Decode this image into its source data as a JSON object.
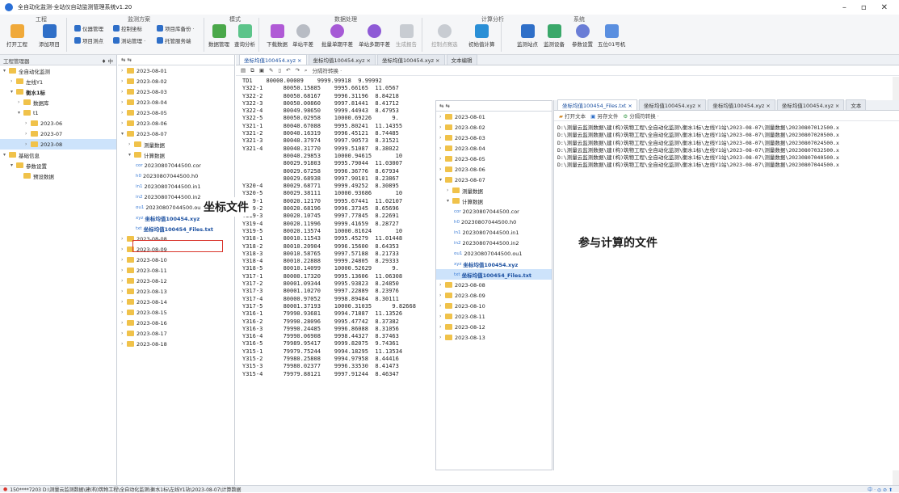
{
  "window": {
    "title": "全自动化监测-全站仪自动监测管理系统v1.20"
  },
  "ribbon": {
    "groups": [
      {
        "label": "工程"
      },
      {
        "label": "监测方案"
      },
      {
        "label": "模式"
      },
      {
        "label": "数据处理"
      },
      {
        "label": "计算分析"
      },
      {
        "label": "系统"
      }
    ],
    "buttons": [
      "打开工程",
      "添加项目",
      "数据管理",
      "查询分析",
      "下载数据",
      "单站平差",
      "批量单期平差",
      "单站多期平差",
      "生成报告",
      "控制点赛选",
      "初始值计算",
      "监测站点",
      "监测设备",
      "参数设置",
      "五位01号机"
    ],
    "small_buttons": [
      "仪器管理",
      "控制坐标",
      "项目库备份 ·",
      "项目测点",
      "测站管理 ·",
      "托管服务端"
    ]
  },
  "left_panel": {
    "header": "工程管理器",
    "pin": "♦ 中",
    "nodes": [
      {
        "label": "全自动化监测",
        "depth": 0,
        "arrow": "▾"
      },
      {
        "label": "左线Y1",
        "depth": 1,
        "arrow": "›"
      },
      {
        "label": "衡水1标",
        "depth": 1,
        "arrow": "▾",
        "bold": true
      },
      {
        "label": "数据库",
        "depth": 2,
        "arrow": "›"
      },
      {
        "label": "t1",
        "depth": 2,
        "arrow": "▾"
      },
      {
        "label": "2023-06",
        "depth": 3,
        "arrow": "›"
      },
      {
        "label": "2023-07",
        "depth": 3,
        "arrow": "›"
      },
      {
        "label": "2023-08",
        "depth": 3,
        "arrow": "›",
        "selected": true
      },
      {
        "label": "基础信息",
        "depth": 0,
        "arrow": "▾"
      },
      {
        "label": "参数设置",
        "depth": 1,
        "arrow": "▾"
      },
      {
        "label": "预设数据",
        "depth": 2,
        "arrow": ""
      }
    ]
  },
  "mid_panel": {
    "header_icons": "⇆ ⇆",
    "nodes": [
      {
        "label": "2023-08-01",
        "depth": 0,
        "type": "folder"
      },
      {
        "label": "2023-08-02",
        "depth": 0,
        "type": "folder"
      },
      {
        "label": "2023-08-03",
        "depth": 0,
        "type": "folder"
      },
      {
        "label": "2023-08-04",
        "depth": 0,
        "type": "folder"
      },
      {
        "label": "2023-08-05",
        "depth": 0,
        "type": "folder"
      },
      {
        "label": "2023-08-06",
        "depth": 0,
        "type": "folder"
      },
      {
        "label": "2023-08-07",
        "depth": 0,
        "type": "folder",
        "open": true
      },
      {
        "label": "测量数据",
        "depth": 1,
        "type": "folder"
      },
      {
        "label": "计算数据",
        "depth": 1,
        "type": "folder",
        "open": true
      },
      {
        "label": "20230807044500.cor",
        "depth": 2,
        "type": "file",
        "ext": "cor"
      },
      {
        "label": "20230807044500.h0",
        "depth": 2,
        "type": "file",
        "ext": "h0"
      },
      {
        "label": "20230807044500.in1",
        "depth": 2,
        "type": "file",
        "ext": "in1"
      },
      {
        "label": "20230807044500.in2",
        "depth": 2,
        "type": "file",
        "ext": "in2"
      },
      {
        "label": "20230807044500.ou1",
        "depth": 2,
        "type": "file",
        "ext": "ou1"
      },
      {
        "label": "坐标均值100454.xyz",
        "depth": 2,
        "type": "file",
        "ext": "xyz",
        "highlight": true
      },
      {
        "label": "坐标均值100454_Files.txt",
        "depth": 2,
        "type": "file",
        "ext": "txt",
        "blue": true
      },
      {
        "label": "2023-08-08",
        "depth": 0,
        "type": "folder"
      },
      {
        "label": "2023-08-09",
        "depth": 0,
        "type": "folder"
      },
      {
        "label": "2023-08-10",
        "depth": 0,
        "type": "folder"
      },
      {
        "label": "2023-08-11",
        "depth": 0,
        "type": "folder"
      },
      {
        "label": "2023-08-12",
        "depth": 0,
        "type": "folder"
      },
      {
        "label": "2023-08-13",
        "depth": 0,
        "type": "folder"
      },
      {
        "label": "2023-08-14",
        "depth": 0,
        "type": "folder"
      },
      {
        "label": "2023-08-15",
        "depth": 0,
        "type": "folder"
      },
      {
        "label": "2023-08-16",
        "depth": 0,
        "type": "folder"
      },
      {
        "label": "2023-08-17",
        "depth": 0,
        "type": "folder"
      },
      {
        "label": "2023-08-18",
        "depth": 0,
        "type": "folder"
      }
    ]
  },
  "editor": {
    "tabs": [
      "坐标均值100454.xyz ×",
      "坐标均值100454.xyz ×",
      "坐标均值100454.xyz ×",
      "文本编辑"
    ],
    "toolbar_text": "分隔符转换 ·",
    "lines": [
      "TD1    80000.00009    9999.99918  9.99992",
      "Y322-1      80050.15885    9995.66165  11.0567",
      "Y322-2      80050.68167    9996.31196  8.84218",
      "Y322-3      80050.00860    9997.81441  8.41712",
      "Y322-4      80049.98650    9999.44943  8.47953",
      "Y322-5      80050.02958    10000.69226      9.",
      "Y321-1      80040.67088    9995.80241  11.14355",
      "Y321-2      80040.16319    9996.45121  8.74485",
      "Y321-3      80040.37974    9997.90573  8.31521",
      "Y321-4      80040.31770    9999.51087  8.38022",
      "            80040.29853    10000.94615       10",
      "            80029.91803    9995.79044  11.03007",
      "            80029.67258    9996.36776  8.67934",
      "            80029.68938    9997.90101  8.23867",
      "Y320-4      80029.68771    9999.49252  8.30895",
      "Y320-5      80029.38111    10000.93686       10",
      "Y319-1      80020.12170    9995.67441  11.02107",
      "Y319-2      80020.68196    9996.37345  8.65696",
      "Y319-3      80020.10745    9997.77845  8.22691",
      "Y319-4      80020.11996    9999.41659  8.28727",
      "Y319-5      80020.13574    10000.81624       10",
      "Y318-1      80010.11543    9995.45279  11.01448",
      "Y318-2      80010.20904    9996.15600  8.64353",
      "Y318-3      80010.58765    9997.57188  8.21733",
      "Y318-4      80010.22888    9999.24805  8.29333",
      "Y318-5      80010.14099    10000.52629      9.",
      "Y317-1      80000.17320    9995.13606  11.06308",
      "Y317-2      80001.09344    9995.93823  8.24850",
      "Y317-3      80001.10270    9997.22889  8.23976",
      "Y317-4      80000.97052    9998.89484  8.30111",
      "Y317-5      80001.37193    10000.31035      9.82668",
      "Y316-1      79990.93681    9994.71887  11.13526",
      "Y316-2      79990.28096    9995.47742  8.37382",
      "Y316-3      79990.24485    9996.86088  8.31056",
      "Y316-4      79990.06908    9998.44327  8.37463",
      "Y316-5      79989.95417    9999.82075  9.74361",
      "Y315-1      79979.75244    9994.18295  11.13534",
      "Y315-2      79980.25808    9994.97958  8.44416",
      "Y315-3      79980.02377    9996.33530  8.41473",
      "Y315-4      79979.88121    9997.91244  8.46347"
    ]
  },
  "overlay_tree": {
    "header_icons": "⇆ ⇆",
    "nodes": [
      {
        "label": "2023-08-01",
        "depth": 0,
        "type": "folder"
      },
      {
        "label": "2023-08-02",
        "depth": 0,
        "type": "folder"
      },
      {
        "label": "2023-08-03",
        "depth": 0,
        "type": "folder"
      },
      {
        "label": "2023-08-04",
        "depth": 0,
        "type": "folder"
      },
      {
        "label": "2023-08-05",
        "depth": 0,
        "type": "folder"
      },
      {
        "label": "2023-08-06",
        "depth": 0,
        "type": "folder"
      },
      {
        "label": "2023-08-07",
        "depth": 0,
        "type": "folder",
        "open": true
      },
      {
        "label": "测量数据",
        "depth": 1,
        "type": "folder"
      },
      {
        "label": "计算数据",
        "depth": 1,
        "type": "folder",
        "open": true
      },
      {
        "label": "20230807044500.cor",
        "depth": 2,
        "type": "file",
        "ext": "cor"
      },
      {
        "label": "20230807044500.h0",
        "depth": 2,
        "type": "file",
        "ext": "h0"
      },
      {
        "label": "20230807044500.in1",
        "depth": 2,
        "type": "file",
        "ext": "in1"
      },
      {
        "label": "20230807044500.in2",
        "depth": 2,
        "type": "file",
        "ext": "in2"
      },
      {
        "label": "20230807044500.ou1",
        "depth": 2,
        "type": "file",
        "ext": "ou1"
      },
      {
        "label": "坐标均值100454.xyz",
        "depth": 2,
        "type": "file",
        "ext": "xyz",
        "blue": true
      },
      {
        "label": "坐标均值100454_Files.txt",
        "depth": 2,
        "type": "file",
        "ext": "txt",
        "blue": true,
        "selected": true
      },
      {
        "label": "2023-08-08",
        "depth": 0,
        "type": "folder"
      },
      {
        "label": "2023-08-09",
        "depth": 0,
        "type": "folder"
      },
      {
        "label": "2023-08-10",
        "depth": 0,
        "type": "folder"
      },
      {
        "label": "2023-08-11",
        "depth": 0,
        "type": "folder"
      },
      {
        "label": "2023-08-12",
        "depth": 0,
        "type": "folder"
      },
      {
        "label": "2023-08-13",
        "depth": 0,
        "type": "folder"
      }
    ]
  },
  "overlay_editor": {
    "tabs": [
      "坐标均值100454_Files.txt ×",
      "坐标均值100454.xyz ×",
      "坐标均值100454.xyz ×",
      "坐标均值100454.xyz ×",
      "文本"
    ],
    "toolbar": [
      "打开文本",
      "另存文件",
      "分隔符转换 ·"
    ],
    "lines": [
      "D:\\测量云监测数据\\建(构)筑物工程\\全自动化监测\\衡水1标\\左线Y1站\\2023-08-07\\测量数据\\20230807012500.x",
      "D:\\测量云监测数据\\建(构)筑物工程\\全自动化监测\\衡水1标\\左线Y1站\\2023-08-07\\测量数据\\20230807020500.x",
      "D:\\测量云监测数据\\建(构)筑物工程\\全自动化监测\\衡水1标\\左线Y1站\\2023-08-07\\测量数据\\20230807024500.x",
      "D:\\测量云监测数据\\建(构)筑物工程\\全自动化监测\\衡水1标\\左线Y1站\\2023-08-07\\测量数据\\20230807032500.x",
      "D:\\测量云监测数据\\建(构)筑物工程\\全自动化监测\\衡水1标\\左线Y1站\\2023-08-07\\测量数据\\20230807040500.x",
      "D:\\测量云监测数据\\建(构)筑物工程\\全自动化监测\\衡水1标\\左线Y1站\\2023-08-07\\测量数据\\20230807044500.x"
    ]
  },
  "annotations": {
    "coord_file": "坐标文件",
    "calc_files": "参与计算的文件"
  },
  "statusbar": {
    "text": "150****7203  D:\\测量云监测数据\\建(构)筑物工程\\全自动化监测\\衡水1标\\左线Y1站\\2023-08-07\\计算数据",
    "tray": "中 · ◎ ⊘ ⬆"
  },
  "colors": {
    "accent": "#2f6fc8",
    "folder": "#f0c24a",
    "callout_border": "#d9342b",
    "selection": "#cde3fb"
  }
}
